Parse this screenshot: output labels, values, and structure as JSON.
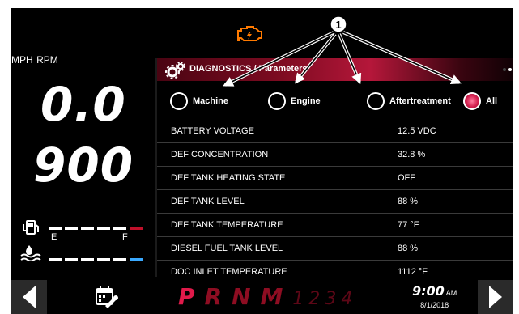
{
  "callout": {
    "number": "1"
  },
  "header": {
    "title": "DIAGNOSTICS / Parameters"
  },
  "gauges": {
    "speed": {
      "value": "0.0",
      "unit": "MPH"
    },
    "rpm": {
      "value": "900",
      "unit": "RPM"
    },
    "fuel": {
      "empty_label": "E",
      "full_label": "F"
    }
  },
  "filters": [
    {
      "label": "Machine",
      "selected": false
    },
    {
      "label": "Engine",
      "selected": false
    },
    {
      "label": "Aftertreatment",
      "selected": false
    },
    {
      "label": "All",
      "selected": true
    }
  ],
  "parameters": [
    {
      "name": "BATTERY VOLTAGE",
      "value": "12.5 VDC"
    },
    {
      "name": "DEF CONCENTRATION",
      "value": "32.8 %"
    },
    {
      "name": "DEF TANK HEATING STATE",
      "value": "OFF"
    },
    {
      "name": "DEF TANK LEVEL",
      "value": "88 %"
    },
    {
      "name": "DEF TANK TEMPERATURE",
      "value": "77 °F"
    },
    {
      "name": "DIESEL FUEL TANK LEVEL",
      "value": "88 %"
    },
    {
      "name": "DOC INLET TEMPERATURE",
      "value": "1112 °F"
    }
  ],
  "gear_selector": {
    "active": "P",
    "others": [
      "R",
      "N",
      "M"
    ],
    "numbers": [
      "1",
      "2",
      "3",
      "4"
    ]
  },
  "clock": {
    "time": "9:00",
    "ampm": "AM",
    "date": "8/1/2018"
  },
  "icons": [
    "check-engine-icon",
    "gear-icon",
    "fuel-pump-icon",
    "def-fluid-icon",
    "maintenance-calendar-icon",
    "left-arrow-icon",
    "right-arrow-icon"
  ],
  "colors": {
    "accent": "#b5173a",
    "warning": "#ff7a00",
    "def_blue": "#3aa9ff",
    "fuel_red": "#c0102a"
  }
}
